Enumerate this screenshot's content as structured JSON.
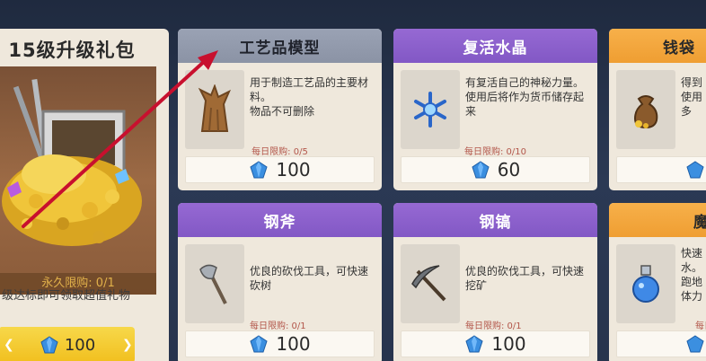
{
  "gift_panel": {
    "title": "15级升级礼包",
    "limit": "永久限购: 0/1",
    "description": "级达标即可领取超值礼物",
    "price": "100"
  },
  "cards": [
    {
      "title": "工艺品模型",
      "header": "gray",
      "description": "用于制造工艺品的主要材料。\n物品不可删除",
      "limit": "每日限购: 0/5",
      "price": "100",
      "icon": "wood-stump-icon"
    },
    {
      "title": "复活水晶",
      "header": "purple",
      "description": "有复活自己的神秘力量。\n使用后将作为货币储存起来",
      "limit": "每日限购: 0/10",
      "price": "60",
      "icon": "snowflake-crystal-icon"
    },
    {
      "title": "钱袋",
      "header": "orange",
      "description": "得到\n使用\n多",
      "limit": "",
      "price": "",
      "icon": "money-bag-icon"
    },
    {
      "title": "钢斧",
      "header": "purple",
      "description": "优良的砍伐工具，可快速砍树",
      "limit": "每日限购: 0/1",
      "price": "100",
      "icon": "axe-icon"
    },
    {
      "title": "钢镐",
      "header": "purple",
      "description": "优良的砍伐工具，可快速挖矿",
      "limit": "每日限购: 0/1",
      "price": "100",
      "icon": "pickaxe-icon"
    },
    {
      "title": "魔",
      "header": "orange",
      "description": "快速\n水。\n跑地\n体力",
      "limit": "每日",
      "price": "",
      "icon": "potion-flask-icon"
    }
  ],
  "colors": {
    "header_gray": "#8b93a5",
    "header_purple": "#8258c5",
    "header_orange": "#ef9e32",
    "gift_button": "#f1bf1e",
    "limit_red": "#b3564a",
    "annotation_red": "#c8102e",
    "gem_blue": "#3b8fe0"
  }
}
